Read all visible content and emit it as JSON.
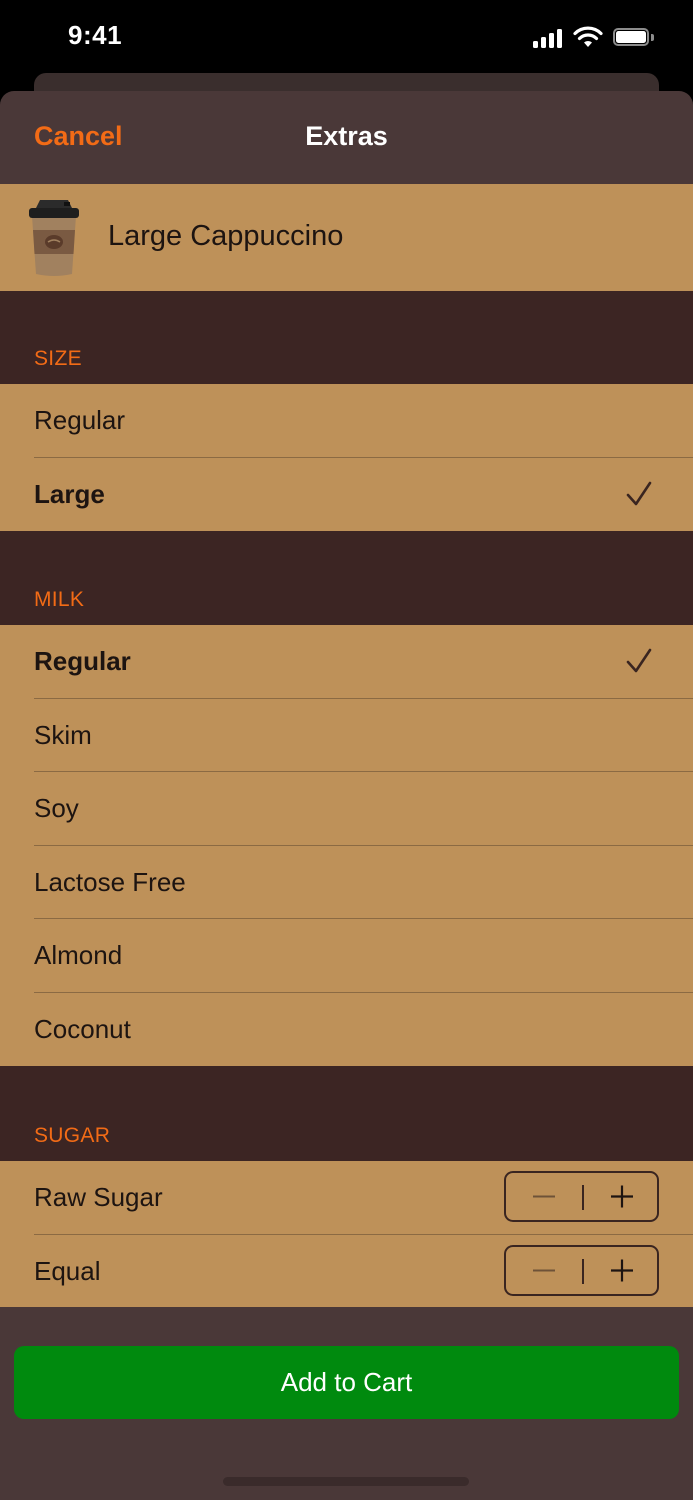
{
  "status_bar": {
    "time": "9:41"
  },
  "nav": {
    "cancel_label": "Cancel",
    "title": "Extras"
  },
  "product": {
    "name": "Large Cappuccino",
    "icon": "coffee-cup-icon"
  },
  "sections": {
    "size": {
      "header": "SIZE",
      "options": [
        {
          "label": "Regular",
          "selected": false
        },
        {
          "label": "Large",
          "selected": true
        }
      ]
    },
    "milk": {
      "header": "MILK",
      "options": [
        {
          "label": "Regular",
          "selected": true
        },
        {
          "label": "Skim",
          "selected": false
        },
        {
          "label": "Soy",
          "selected": false
        },
        {
          "label": "Lactose Free",
          "selected": false
        },
        {
          "label": "Almond",
          "selected": false
        },
        {
          "label": "Coconut",
          "selected": false
        }
      ]
    },
    "sugar": {
      "header": "SUGAR",
      "options": [
        {
          "label": "Raw Sugar"
        },
        {
          "label": "Equal"
        }
      ]
    }
  },
  "footer": {
    "add_to_cart_label": "Add to Cart"
  },
  "colors": {
    "accent": "#f26b16",
    "row_background": "#be9159",
    "section_background": "#3c2523",
    "sheet_background": "#4a3838",
    "button_green": "#008a0e"
  }
}
